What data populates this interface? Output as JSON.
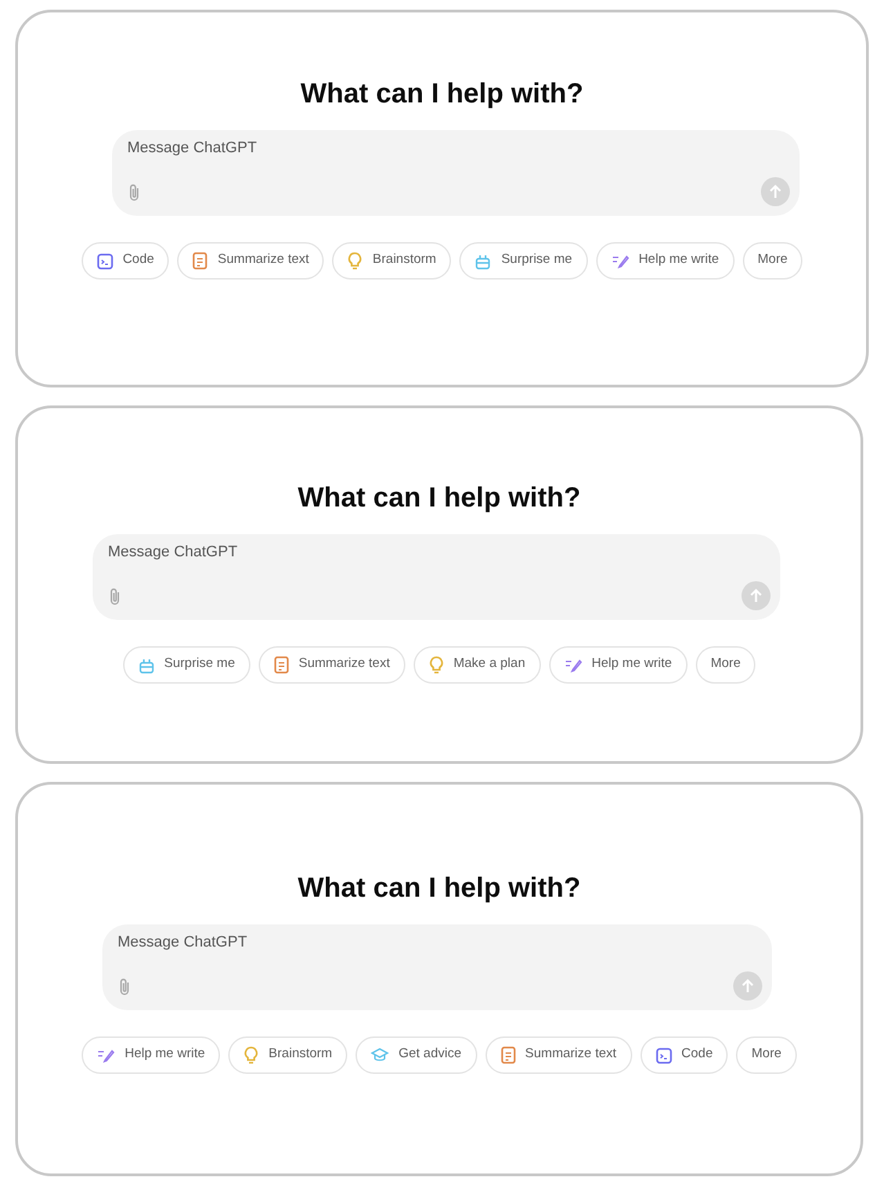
{
  "panels": [
    {
      "heading": "What can I help with?",
      "composer": {
        "placeholder": "Message ChatGPT"
      },
      "suggestions": [
        {
          "kind": "code",
          "label": "Code"
        },
        {
          "kind": "summarize",
          "label": "Summarize text"
        },
        {
          "kind": "brainstorm",
          "label": "Brainstorm"
        },
        {
          "kind": "surprise",
          "label": "Surprise me"
        },
        {
          "kind": "write",
          "label": "Help me write"
        },
        {
          "kind": "more",
          "label": "More"
        }
      ]
    },
    {
      "heading": "What can I help with?",
      "composer": {
        "placeholder": "Message ChatGPT"
      },
      "suggestions": [
        {
          "kind": "surprise",
          "label": "Surprise me"
        },
        {
          "kind": "summarize",
          "label": "Summarize text"
        },
        {
          "kind": "brainstorm",
          "label": "Make a plan"
        },
        {
          "kind": "write",
          "label": "Help me write"
        },
        {
          "kind": "more",
          "label": "More"
        }
      ]
    },
    {
      "heading": "What can I help with?",
      "composer": {
        "placeholder": "Message ChatGPT"
      },
      "suggestions": [
        {
          "kind": "write",
          "label": "Help me write"
        },
        {
          "kind": "brainstorm",
          "label": "Brainstorm"
        },
        {
          "kind": "advice",
          "label": "Get advice"
        },
        {
          "kind": "summarize",
          "label": "Summarize text"
        },
        {
          "kind": "code",
          "label": "Code"
        },
        {
          "kind": "more",
          "label": "More"
        }
      ]
    }
  ]
}
